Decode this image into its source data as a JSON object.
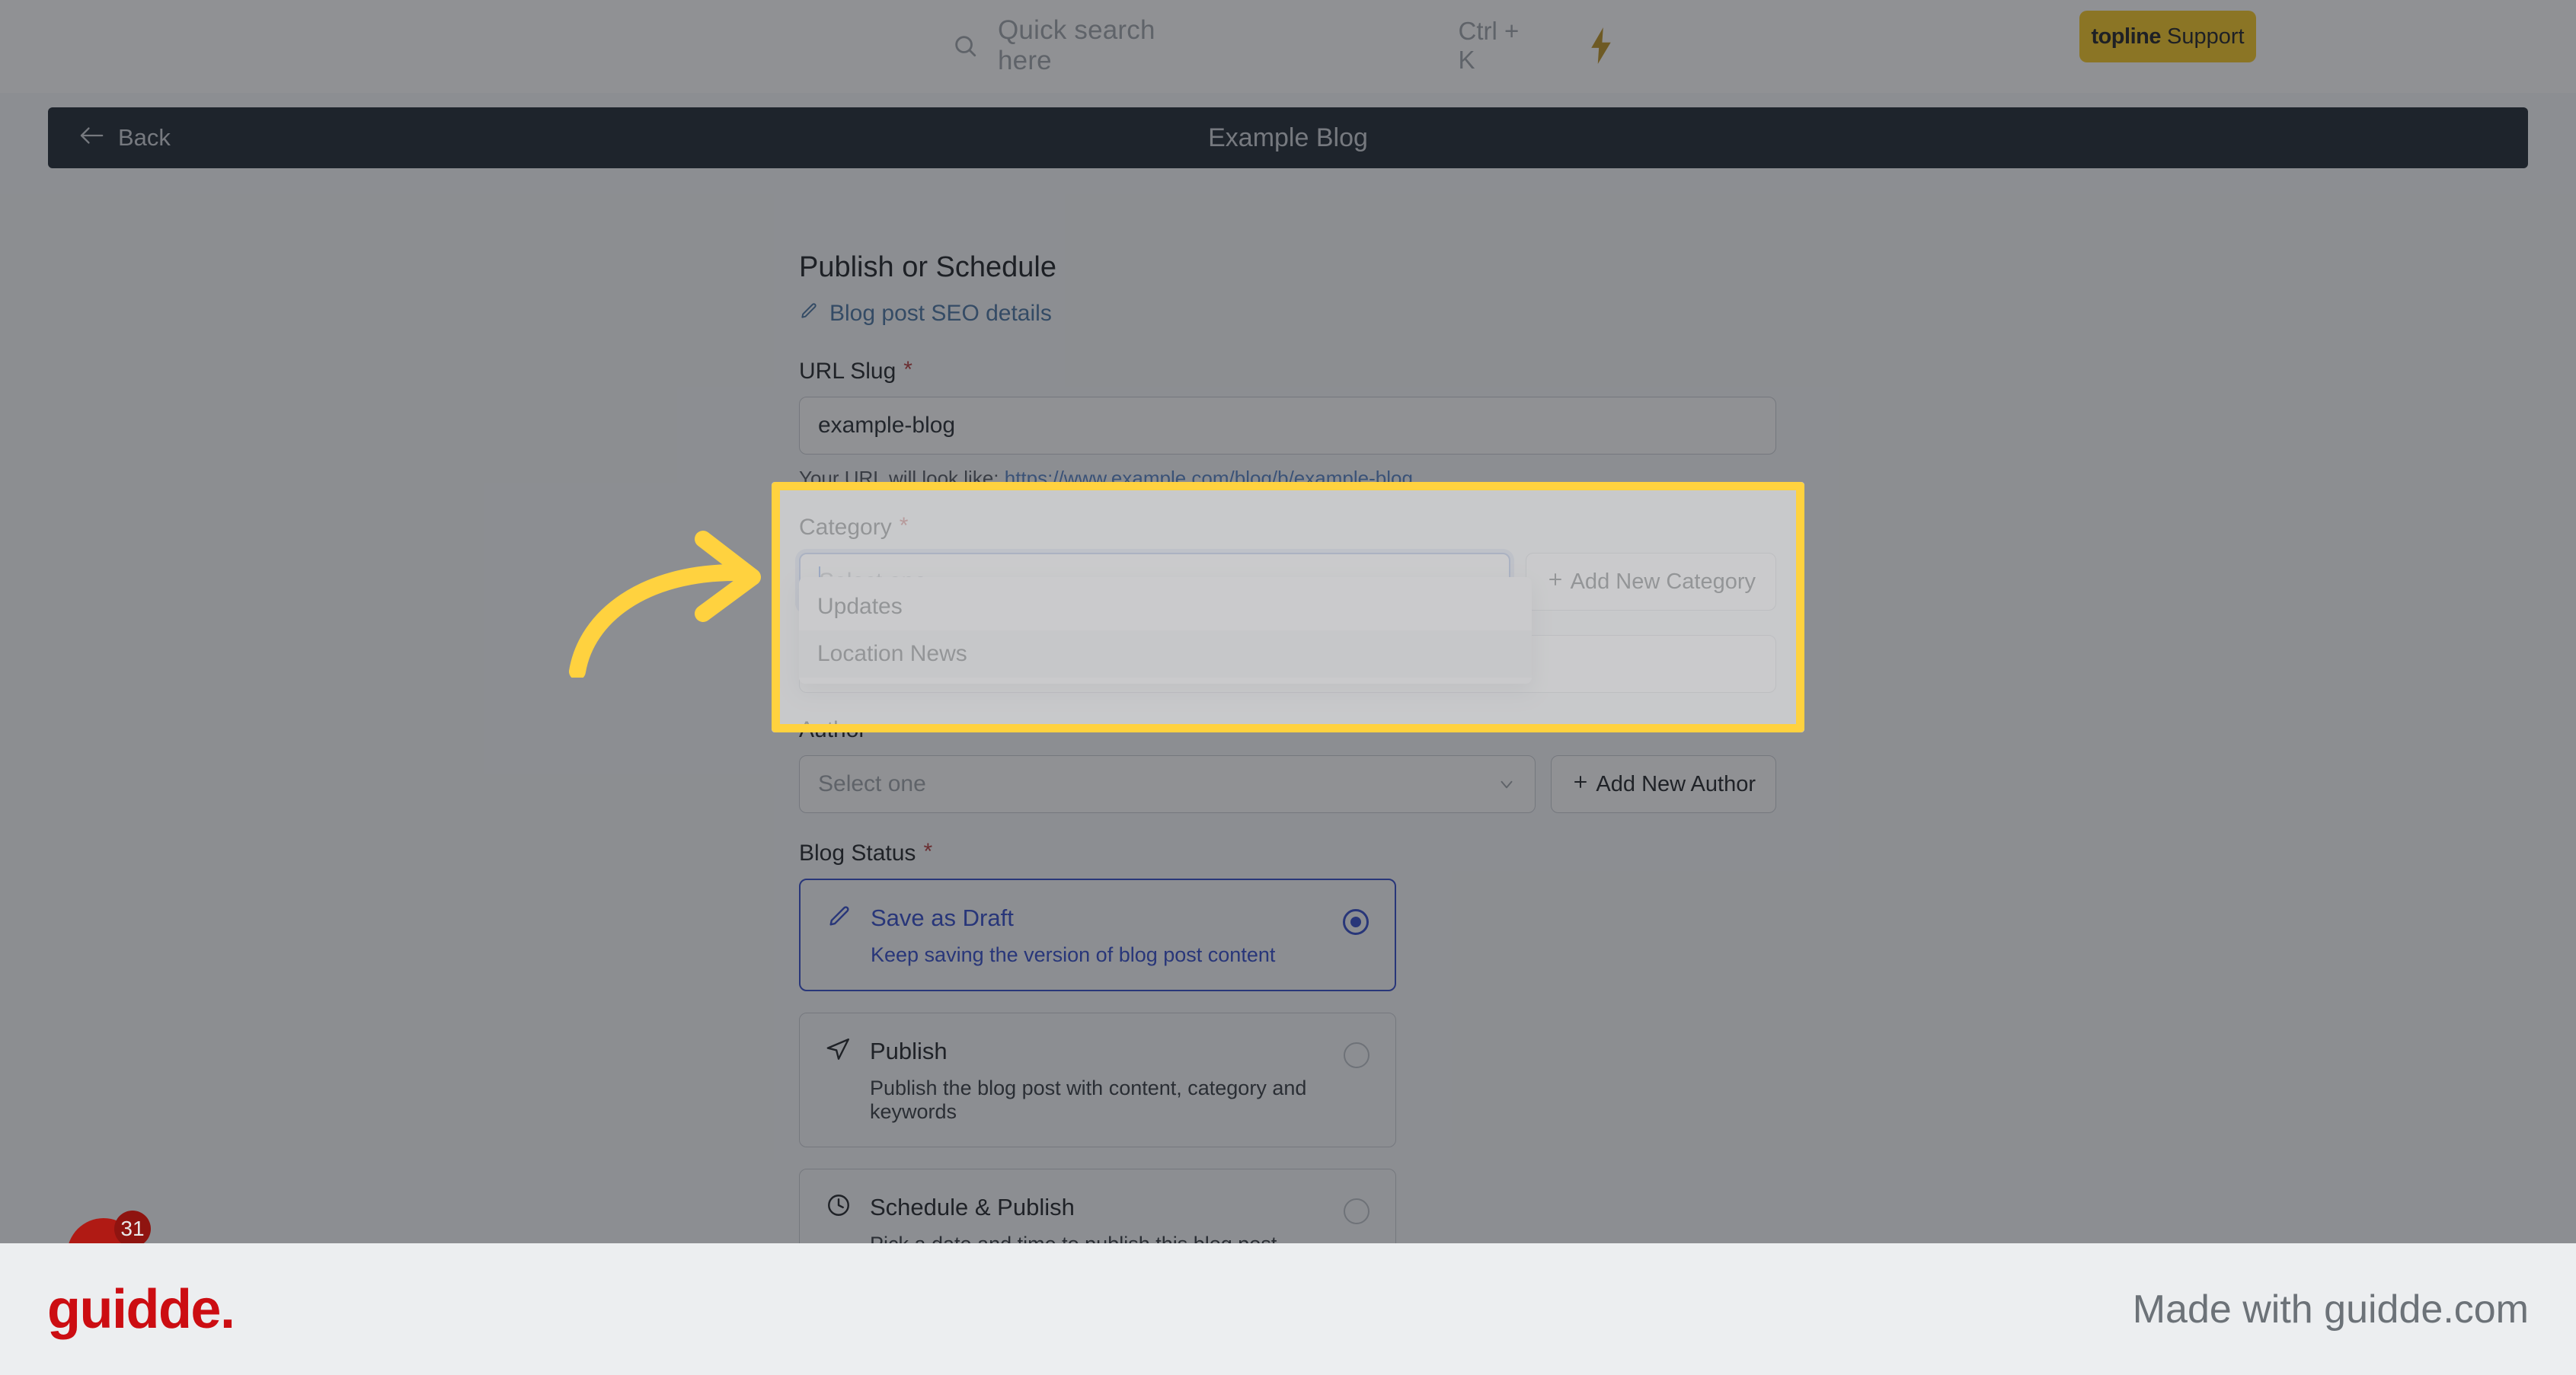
{
  "colors": {
    "highlight_yellow": "#ffd23f",
    "support_button_bg": "#f5c518",
    "header_navy": "#111c26",
    "accent_blue": "#2641c7",
    "link_blue": "#3f6e9e",
    "required_red": "#b03131",
    "guidde_red": "#cc0d12"
  },
  "topbar": {
    "search": {
      "placeholder": "Quick search here",
      "shortcut": "Ctrl + K",
      "icon": "search-icon"
    },
    "bolt_icon": "lightning-bolt-icon",
    "support_button": {
      "brand": "topline",
      "label": "Support"
    }
  },
  "header": {
    "back_label": "Back",
    "back_icon": "arrow-left-icon",
    "title": "Example Blog"
  },
  "form": {
    "section_title": "Publish or Schedule",
    "seo_link": {
      "label": "Blog post SEO details",
      "icon": "pencil-icon"
    },
    "url_slug": {
      "label": "URL Slug",
      "required": "*",
      "value": "example-blog",
      "placeholder": "example-blog",
      "hint_prefix": "Your URL will look like:",
      "hint_url": "https://www.example.com/blog/b/example-blog"
    },
    "category": {
      "label": "Category",
      "required": "*",
      "placeholder": "Select one",
      "value": "",
      "add_button": "Add New Category",
      "add_icon": "plus-icon",
      "caret_icon": "chevron-down-icon",
      "options": [
        {
          "label": "Updates",
          "active": false
        },
        {
          "label": "Location News",
          "active": true
        }
      ]
    },
    "author": {
      "label": "Author",
      "placeholder": "Select one",
      "value": "",
      "add_button": "Add New Author",
      "add_icon": "plus-icon",
      "caret_icon": "chevron-down-icon"
    },
    "blog_status": {
      "label": "Blog Status",
      "required": "*",
      "options": [
        {
          "title": "Save as Draft",
          "description": "Keep saving the version of blog post content",
          "icon": "pencil-icon",
          "selected": true
        },
        {
          "title": "Publish",
          "description": "Publish the blog post with content, category and keywords",
          "icon": "send-icon",
          "selected": false
        },
        {
          "title": "Schedule & Publish",
          "description": "Pick a date and time to publish this blog post",
          "icon": "clock-icon",
          "selected": false
        }
      ]
    }
  },
  "widget": {
    "badge_count": "31",
    "icon": "guidde-orb-icon"
  },
  "footer": {
    "logo": "guidde.",
    "tagline": "Made with guidde.com"
  }
}
